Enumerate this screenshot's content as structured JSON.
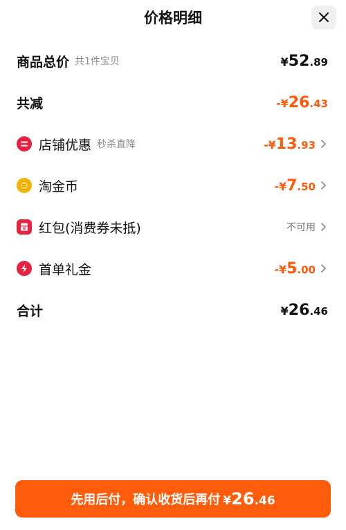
{
  "header": {
    "title": "价格明细"
  },
  "rows": {
    "total_goods": {
      "label": "商品总价",
      "sub": "共1件宝贝",
      "cur": "¥",
      "int": "52",
      "dec": ".89"
    },
    "total_reduce": {
      "label": "共减",
      "cur": "-¥",
      "int": "26",
      "dec": ".43"
    },
    "shop_discount": {
      "label": "店铺优惠",
      "sub": "秒杀直降",
      "cur": "-¥",
      "int": "13",
      "dec": ".93",
      "icon": "minus-badge-icon"
    },
    "gold_coin": {
      "label": "淘金币",
      "cur": "-¥",
      "int": "7",
      "dec": ".50",
      "icon": "gold-coin-icon"
    },
    "red_packet": {
      "label": "红包(消费券未抵)",
      "status": "不可用",
      "icon": "red-packet-icon"
    },
    "first_order": {
      "label": "首单礼金",
      "cur": "-¥",
      "int": "5",
      "dec": ".00",
      "icon": "lightning-icon"
    },
    "sum": {
      "label": "合计",
      "cur": "¥",
      "int": "26",
      "dec": ".46"
    }
  },
  "pay_button": {
    "text": "先用后付，确认收货后再付",
    "cur": "¥",
    "int": "26",
    "dec": ".46"
  },
  "colors": {
    "accent": "#ff5a0a",
    "button": "#ff5c0b",
    "red_icon": "#e5223f",
    "gold_icon": "#f5b400"
  }
}
